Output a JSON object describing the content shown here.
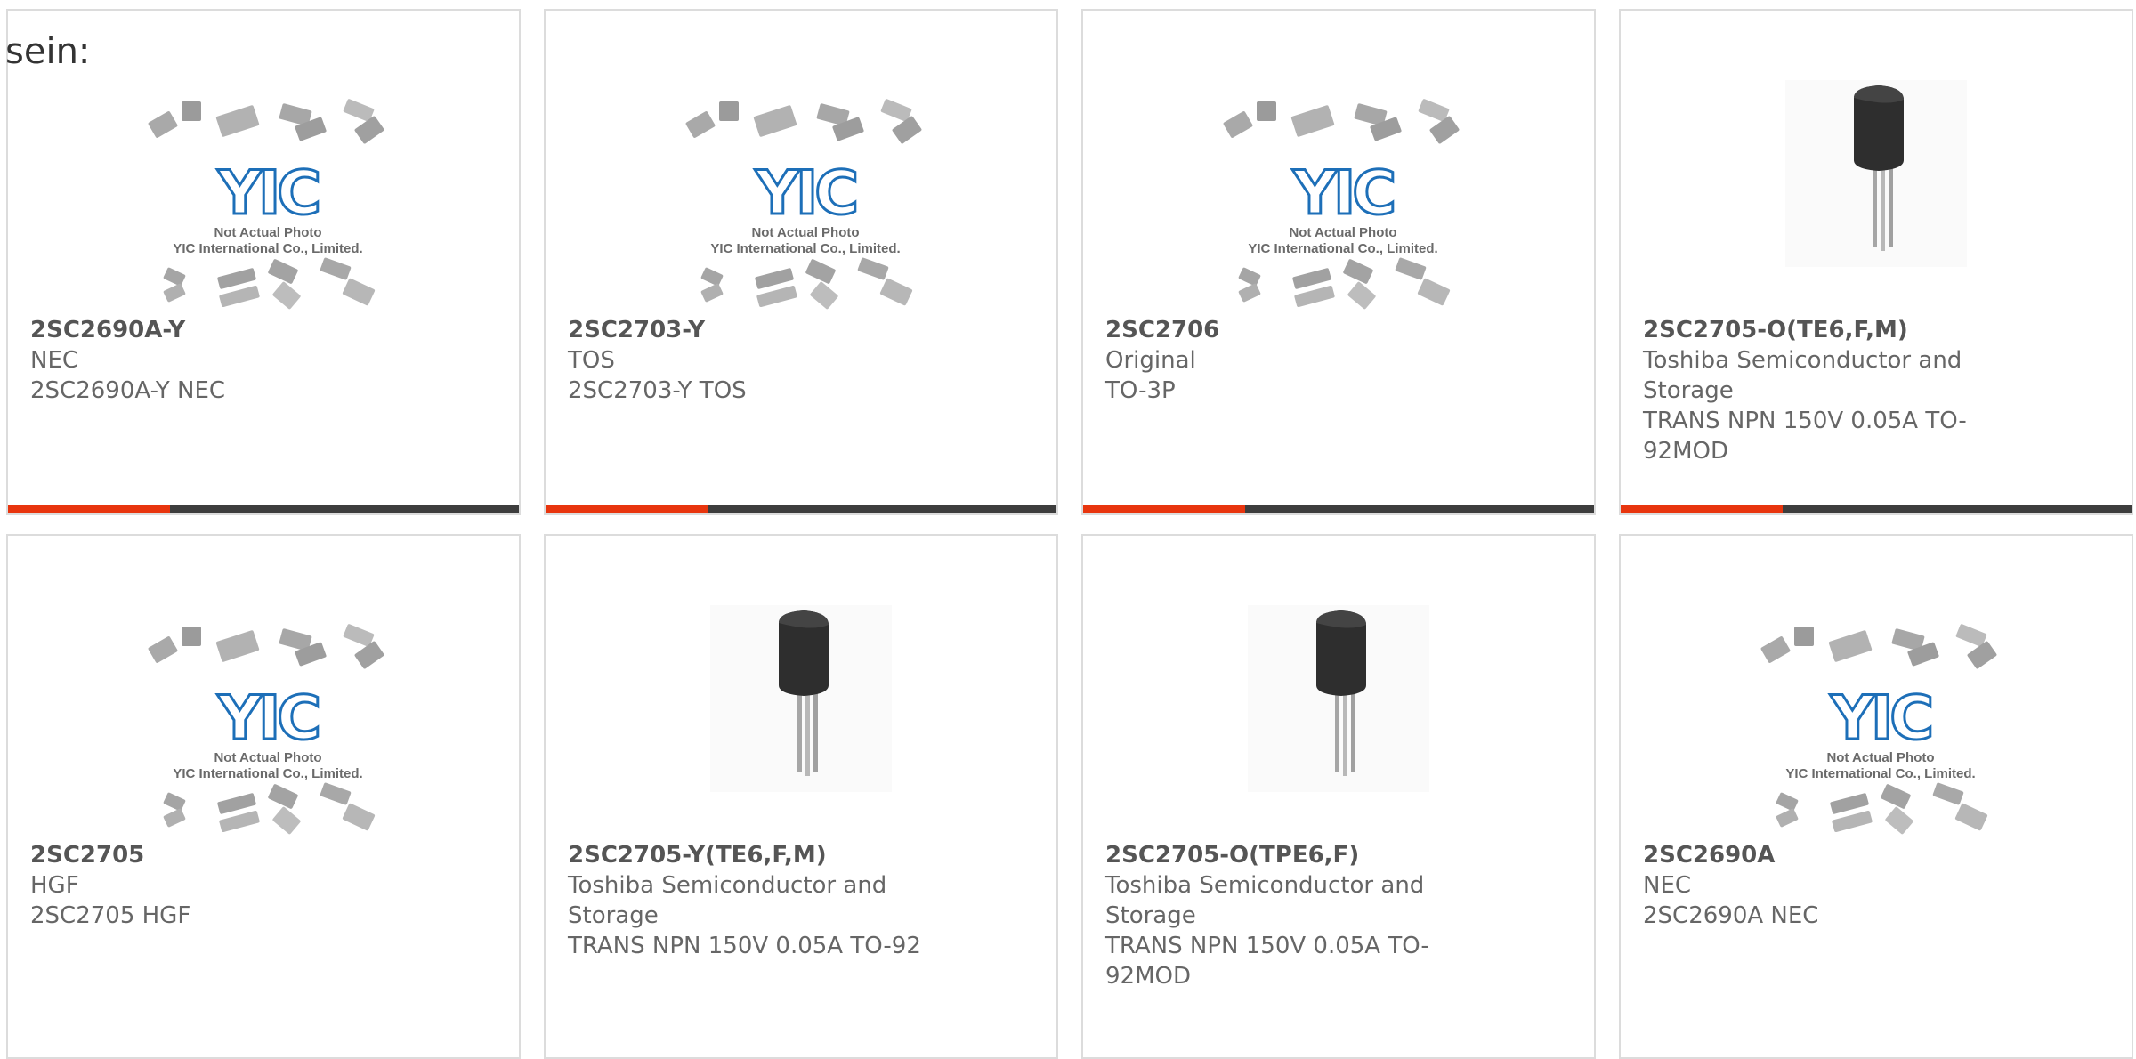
{
  "intro": "sein:",
  "placeholder": {
    "brand": "YIC",
    "line1": "Not Actual Photo",
    "line2": "YIC International Co., Limited."
  },
  "colors": {
    "accent": "#e8350e",
    "bar": "#3d3d3d",
    "border": "#dcdcdc",
    "logo": "#1d6fb8"
  },
  "products": [
    {
      "part": "2SC2690A-Y",
      "mfr": "NEC",
      "desc": "2SC2690A-Y NEC",
      "image": "placeholder-photo"
    },
    {
      "part": "2SC2703-Y",
      "mfr": "TOS",
      "desc": "2SC2703-Y TOS",
      "image": "placeholder-photo"
    },
    {
      "part": "2SC2706",
      "mfr": "Original",
      "desc": "TO-3P",
      "image": "placeholder-photo"
    },
    {
      "part": "2SC2705-O(TE6,F,M)",
      "mfr_lines": [
        "Toshiba Semiconductor and",
        "Storage"
      ],
      "desc_lines": [
        "TRANS NPN 150V 0.05A TO-",
        "92MOD"
      ],
      "image": "transistor-photo"
    },
    {
      "part": "2SC2705",
      "mfr": "HGF",
      "desc": "2SC2705 HGF",
      "image": "placeholder-photo"
    },
    {
      "part": "2SC2705-Y(TE6,F,M)",
      "mfr_lines": [
        "Toshiba Semiconductor and",
        "Storage"
      ],
      "desc": "TRANS NPN 150V 0.05A TO-92",
      "image": "transistor-photo"
    },
    {
      "part": "2SC2705-O(TPE6,F)",
      "mfr_lines": [
        "Toshiba Semiconductor and",
        "Storage"
      ],
      "desc_lines": [
        "TRANS NPN 150V 0.05A TO-",
        "92MOD"
      ],
      "image": "transistor-photo"
    },
    {
      "part": "2SC2690A",
      "mfr": "NEC",
      "desc": "2SC2690A NEC",
      "image": "placeholder-photo"
    }
  ]
}
